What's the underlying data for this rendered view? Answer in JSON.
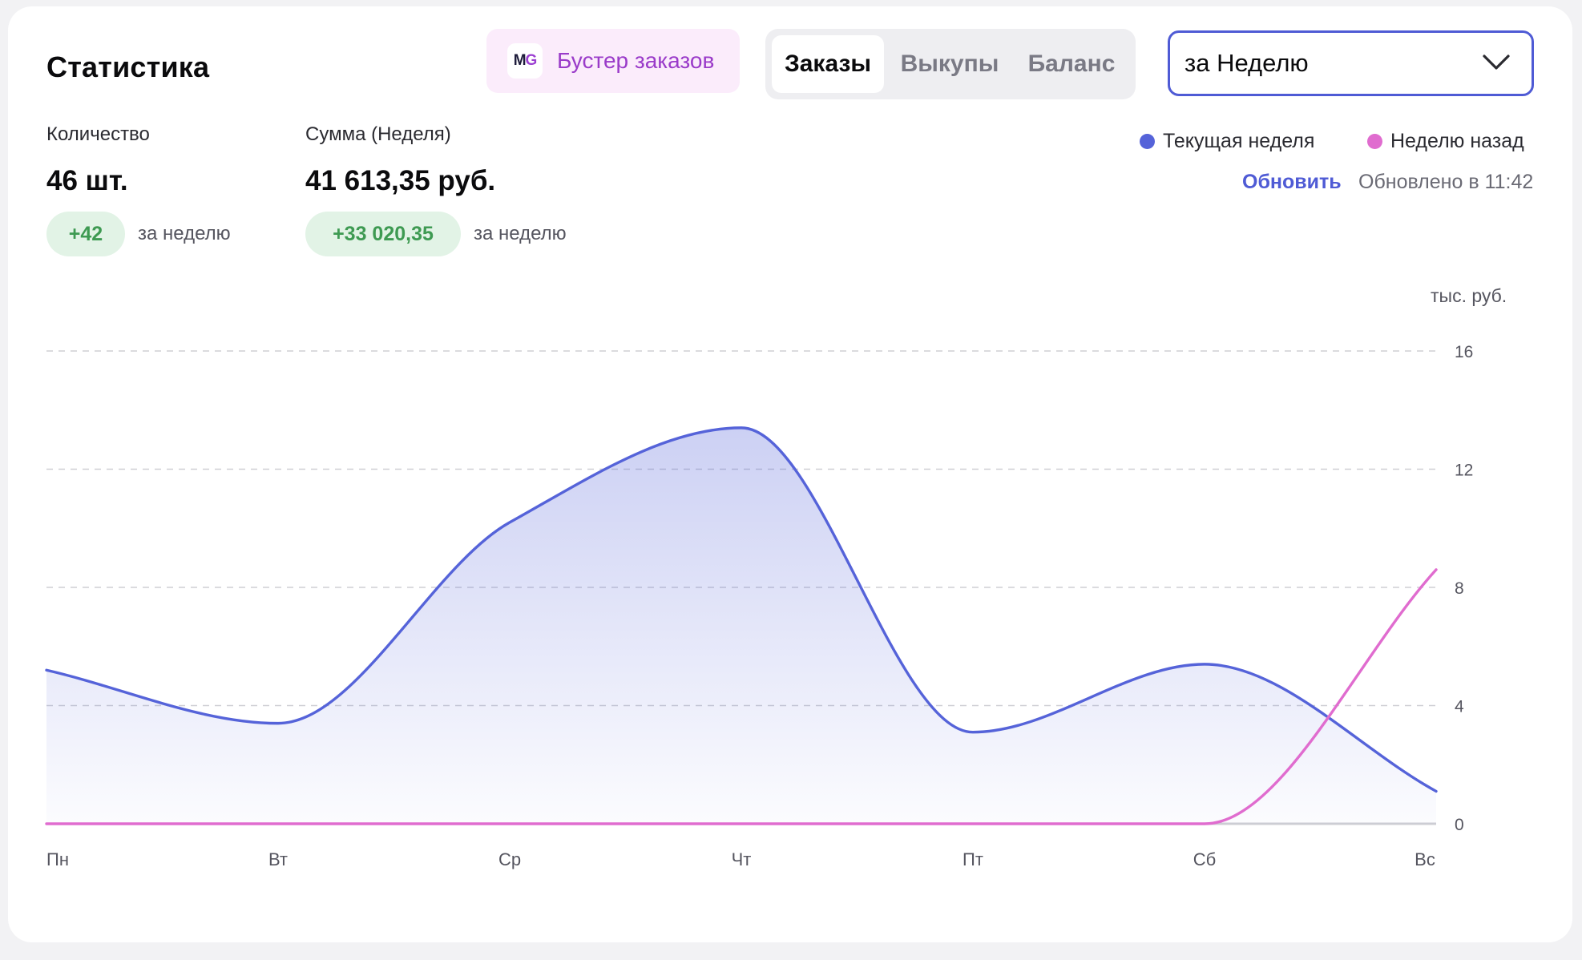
{
  "header": {
    "title": "Статистика",
    "booster_label": "Бустер заказов",
    "booster_logo_m": "M",
    "booster_logo_g": "G",
    "tabs": [
      {
        "label": "Заказы",
        "active": true
      },
      {
        "label": "Выкупы",
        "active": false
      },
      {
        "label": "Баланс",
        "active": false
      }
    ],
    "period_select": "за Неделю"
  },
  "stats": {
    "quantity": {
      "label": "Количество",
      "value": "46 шт.",
      "delta": "+42",
      "delta_note": "за неделю"
    },
    "sum": {
      "label": "Сумма (Неделя)",
      "value": "41 613,35 руб.",
      "delta": "+33 020,35",
      "delta_note": "за неделю"
    }
  },
  "legend": {
    "current": "Текущая неделя",
    "previous": "Неделю назад"
  },
  "refresh": {
    "label": "Обновить",
    "updated": "Обновлено в 11:42"
  },
  "colors": {
    "current": "#5563d9",
    "previous": "#e06ccf",
    "accent": "#4f5bd5",
    "positive": "#3e9a52"
  },
  "chart_data": {
    "type": "area",
    "ylabel": "тыс. руб.",
    "categories": [
      "Пн",
      "Вт",
      "Ср",
      "Чт",
      "Пт",
      "Сб",
      "Вс"
    ],
    "ylim": [
      0,
      16
    ],
    "yticks": [
      0,
      4,
      8,
      12,
      16
    ],
    "grid": true,
    "series": [
      {
        "name": "Текущая неделя",
        "values": [
          5.2,
          3.4,
          10.2,
          13.4,
          3.1,
          5.4,
          1.1
        ]
      },
      {
        "name": "Неделю назад",
        "values": [
          0,
          0,
          0,
          0,
          0,
          0,
          8.6
        ]
      }
    ]
  }
}
